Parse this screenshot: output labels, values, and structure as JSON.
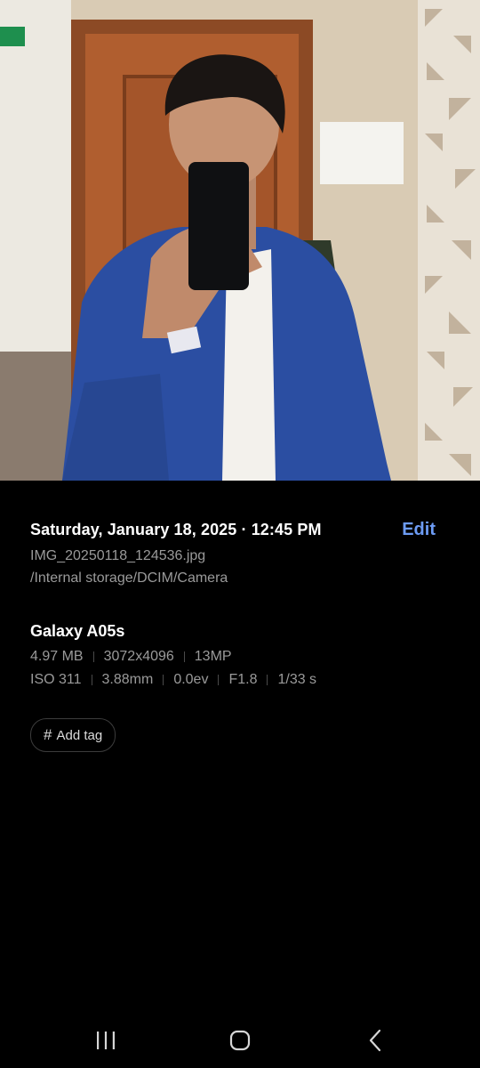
{
  "photo": {
    "subject": "mirror-selfie-photo"
  },
  "details": {
    "datetime": "Saturday, January 18, 2025 · 12:45 PM",
    "edit_label": "Edit",
    "file_name": "IMG_20250118_124536.jpg",
    "file_path": "/Internal storage/DCIM/Camera"
  },
  "camera": {
    "device": "Galaxy A05s",
    "file_info": [
      "4.97 MB",
      "3072x4096",
      "13MP"
    ],
    "exposure": [
      "ISO 311",
      "3.88mm",
      "0.0ev",
      "F1.8",
      "1/33 s"
    ]
  },
  "tag": {
    "label": "Add tag"
  },
  "navbar": {
    "icons": [
      "recents-icon",
      "home-icon",
      "back-icon"
    ]
  },
  "colors": {
    "accent": "#6d9cf5",
    "background": "#000000",
    "secondary_text": "#9a9a9a"
  }
}
